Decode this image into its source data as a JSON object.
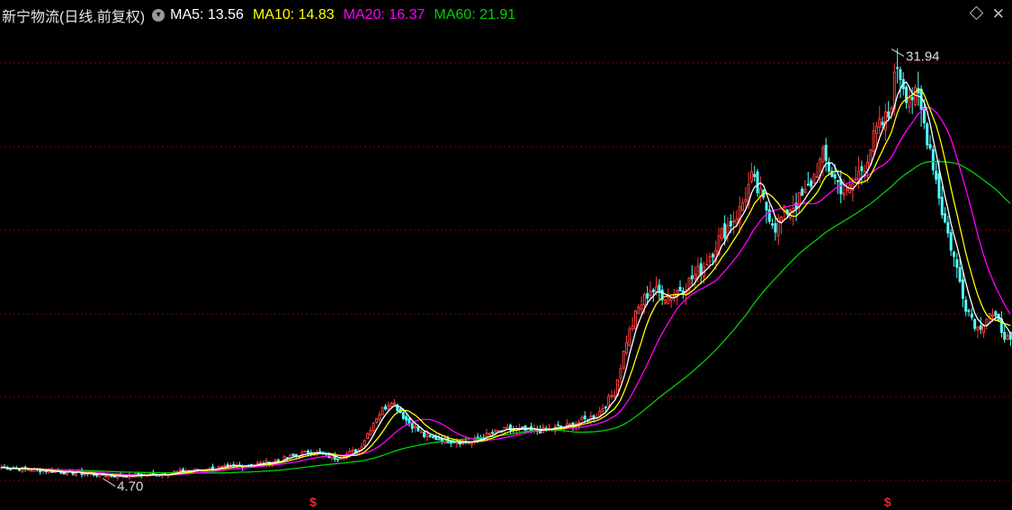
{
  "header": {
    "title": "新宁物流(日线.前复权)",
    "settings_icon": "chevron-down-circle-icon",
    "ma_labels": [
      {
        "name": "MA5",
        "text": "MA5: 13.56",
        "color": "#ffffff"
      },
      {
        "name": "MA10",
        "text": "MA10: 14.83",
        "color": "#ffff00"
      },
      {
        "name": "MA20",
        "text": "MA20: 16.37",
        "color": "#ff00ff"
      },
      {
        "name": "MA60",
        "text": "MA60: 21.91",
        "color": "#00d000"
      }
    ],
    "right_icons": [
      "diamond-icon",
      "close-icon"
    ]
  },
  "chart_data": {
    "type": "candlestick",
    "ylim": [
      4.0,
      33.0
    ],
    "grid": "dotted horizontal",
    "colors": {
      "up": "#ff3b3b",
      "down": "#54ffff",
      "ma5": "#ffffff",
      "ma10": "#ffff00",
      "ma20": "#ff00ff",
      "ma60": "#00d000",
      "grid": "#8a0000"
    },
    "annotations": {
      "high": "31.94",
      "low": "4.70"
    },
    "markers": [
      "$",
      "$"
    ],
    "anchors": [
      [
        0,
        5.4
      ],
      [
        14,
        5.2
      ],
      [
        28,
        5.0
      ],
      [
        40,
        4.85
      ],
      [
        52,
        4.95
      ],
      [
        64,
        5.2
      ],
      [
        76,
        5.4
      ],
      [
        90,
        5.7
      ],
      [
        104,
        6.4
      ],
      [
        112,
        6.0
      ],
      [
        120,
        6.5
      ],
      [
        126,
        8.6
      ],
      [
        131,
        9.7
      ],
      [
        136,
        8.4
      ],
      [
        142,
        7.4
      ],
      [
        150,
        7.1
      ],
      [
        158,
        7.0
      ],
      [
        164,
        7.5
      ],
      [
        170,
        7.8
      ],
      [
        180,
        7.7
      ],
      [
        190,
        8.0
      ],
      [
        200,
        8.7
      ],
      [
        206,
        10.2
      ],
      [
        210,
        13.5
      ],
      [
        214,
        15.5
      ],
      [
        218,
        16.7
      ],
      [
        224,
        16.2
      ],
      [
        230,
        17.0
      ],
      [
        236,
        18.2
      ],
      [
        242,
        20.2
      ],
      [
        248,
        21.7
      ],
      [
        252,
        23.7
      ],
      [
        256,
        22.2
      ],
      [
        260,
        20.7
      ],
      [
        264,
        21.7
      ],
      [
        270,
        22.7
      ],
      [
        276,
        25.1
      ],
      [
        280,
        23.7
      ],
      [
        284,
        22.7
      ],
      [
        290,
        24.7
      ],
      [
        294,
        26.7
      ],
      [
        298,
        27.7
      ],
      [
        301,
        31.0
      ],
      [
        304,
        29.2
      ],
      [
        308,
        28.7
      ],
      [
        312,
        25.7
      ],
      [
        316,
        21.7
      ],
      [
        320,
        18.7
      ],
      [
        324,
        15.7
      ],
      [
        328,
        14.2
      ],
      [
        332,
        15.2
      ],
      [
        336,
        14.2
      ],
      [
        339,
        13.2
      ]
    ]
  }
}
